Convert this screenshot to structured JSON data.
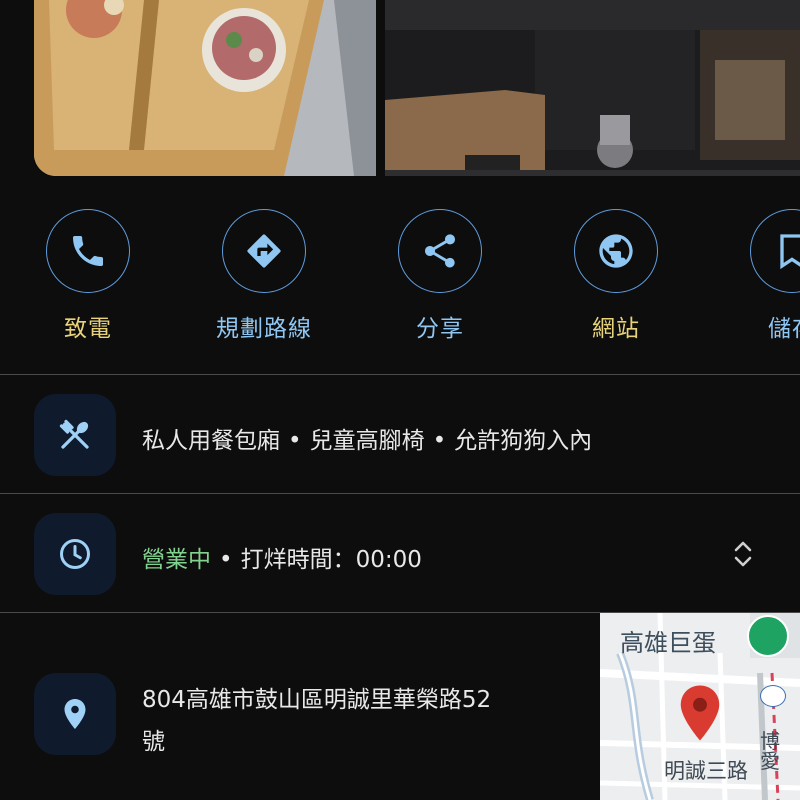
{
  "actions": [
    {
      "label": "致電",
      "icon": "phone-icon"
    },
    {
      "label": "規劃路線",
      "icon": "directions-icon"
    },
    {
      "label": "分享",
      "icon": "share-icon"
    },
    {
      "label": "網站",
      "icon": "globe-icon"
    },
    {
      "label": "儲存",
      "icon": "bookmark-icon"
    }
  ],
  "amenities": {
    "items": [
      "私人用餐包廂",
      "兒童高腳椅",
      "允許狗狗入內"
    ],
    "separator": "•"
  },
  "hours": {
    "status": "營業中",
    "separator": "•",
    "detail": "打烊時間：00:00"
  },
  "address": {
    "line1": "804高雄市鼓山區明誠里華榮路52",
    "line2": "號"
  },
  "map": {
    "poi_label": "高雄巨蛋",
    "street_label": "明誠三路",
    "side_label": "博愛"
  },
  "colors": {
    "background": "#0d0d0d",
    "accent_blue": "#8fc6f2",
    "accent_yellow": "#e9d37a",
    "open_green": "#82d18e",
    "pin_red": "#d93b30"
  }
}
